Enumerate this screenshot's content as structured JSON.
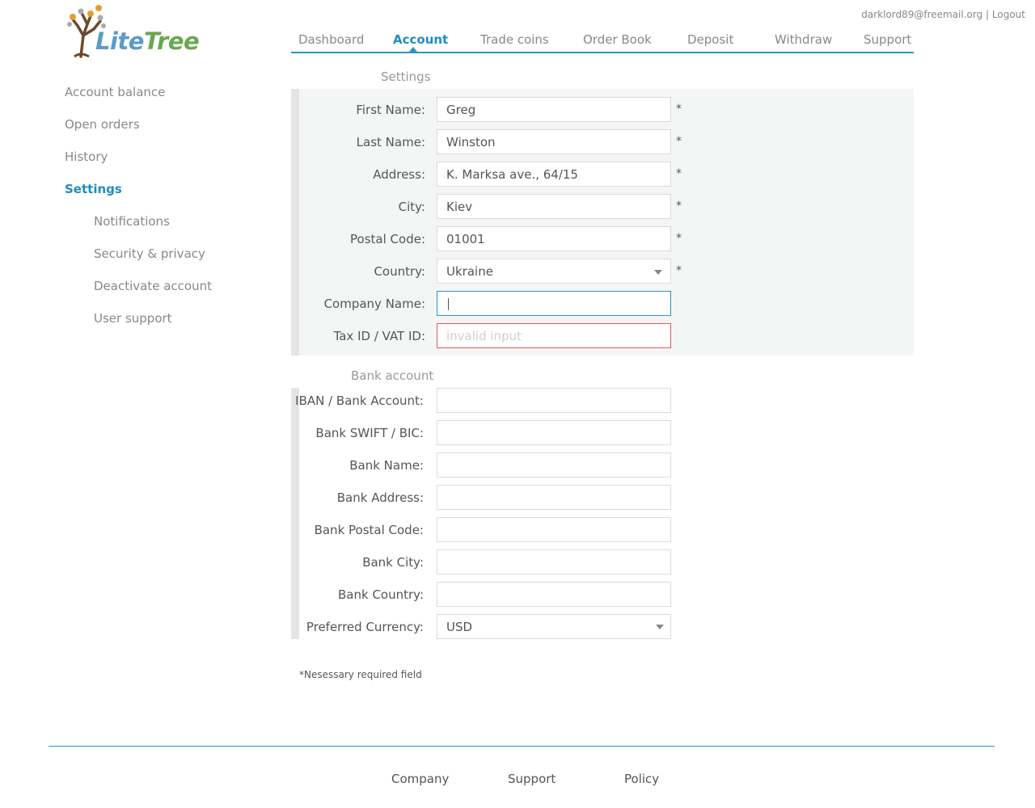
{
  "brand": {
    "lite": "Lite",
    "tree": "Tree"
  },
  "user": {
    "email": "darklord89@freemail.org",
    "separator": " | ",
    "logout": "Logout"
  },
  "nav": {
    "dashboard": "Dashboard",
    "account": "Account",
    "trade": "Trade coins",
    "orderbook": "Order Book",
    "deposit": "Deposit",
    "withdraw": "Withdraw",
    "support": "Support"
  },
  "sidebar": {
    "balance": "Account balance",
    "orders": "Open orders",
    "history": "History",
    "settings": "Settings",
    "notifications": "Notifications",
    "security": "Security & privacy",
    "deactivate": "Deactivate account",
    "support": "User support"
  },
  "settings": {
    "title": "Settings",
    "first_name": {
      "label": "First Name:",
      "value": "Greg"
    },
    "last_name": {
      "label": "Last Name:",
      "value": "Winston"
    },
    "address": {
      "label": "Address:",
      "value": "K. Marksa ave., 64/15"
    },
    "city": {
      "label": "City:",
      "value": "Kiev"
    },
    "postal": {
      "label": "Postal Code:",
      "value": "01001"
    },
    "country": {
      "label": "Country:",
      "value": "Ukraine"
    },
    "company": {
      "label": "Company Name:",
      "value": ""
    },
    "tax": {
      "label": "Tax ID / VAT ID:",
      "placeholder": "invalid input"
    },
    "required_mark": "*"
  },
  "bank": {
    "title": "Bank account",
    "iban": {
      "label": "IBAN / Bank Account:"
    },
    "swift": {
      "label": "Bank SWIFT / BIC:"
    },
    "name": {
      "label": "Bank Name:"
    },
    "address": {
      "label": "Bank Address:"
    },
    "postal": {
      "label": "Bank Postal Code:"
    },
    "city": {
      "label": "Bank City:"
    },
    "country": {
      "label": "Bank Country:"
    },
    "currency": {
      "label": "Preferred Currency:",
      "value": "USD"
    }
  },
  "footnote": "*Nesessary required field",
  "footer": {
    "company": "Company",
    "support": "Support",
    "policy": "Policy"
  },
  "colors": {
    "accent": "#2b97c4",
    "error": "#e05a5a",
    "logo_blue": "#5b9bc8",
    "logo_green": "#6aa84f",
    "panel_bg": "#f4f6f6"
  }
}
